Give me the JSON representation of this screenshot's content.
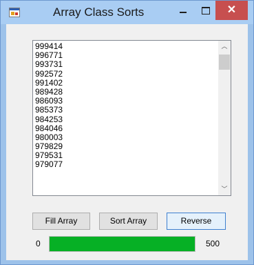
{
  "window": {
    "title": "Array Class Sorts",
    "close_glyph": "✕"
  },
  "list": {
    "items": [
      "999414",
      "996771",
      "993731",
      "992572",
      "991402",
      "989428",
      "986093",
      "985373",
      "984253",
      "984046",
      "980003",
      "979829",
      "979531",
      "979077"
    ],
    "scroll_up_glyph": "︿",
    "scroll_down_glyph": "﹀"
  },
  "buttons": {
    "fill": "Fill Array",
    "sort": "Sort Array",
    "reverse": "Reverse"
  },
  "progress": {
    "min_label": "0",
    "max_label": "500",
    "fraction": 1.0,
    "color": "#06b025"
  },
  "icons": {
    "app": "app-window-icon",
    "minimize": "minimize-icon",
    "maximize": "maximize-icon",
    "close": "close-icon",
    "scroll_up": "chevron-up-icon",
    "scroll_down": "chevron-down-icon"
  }
}
